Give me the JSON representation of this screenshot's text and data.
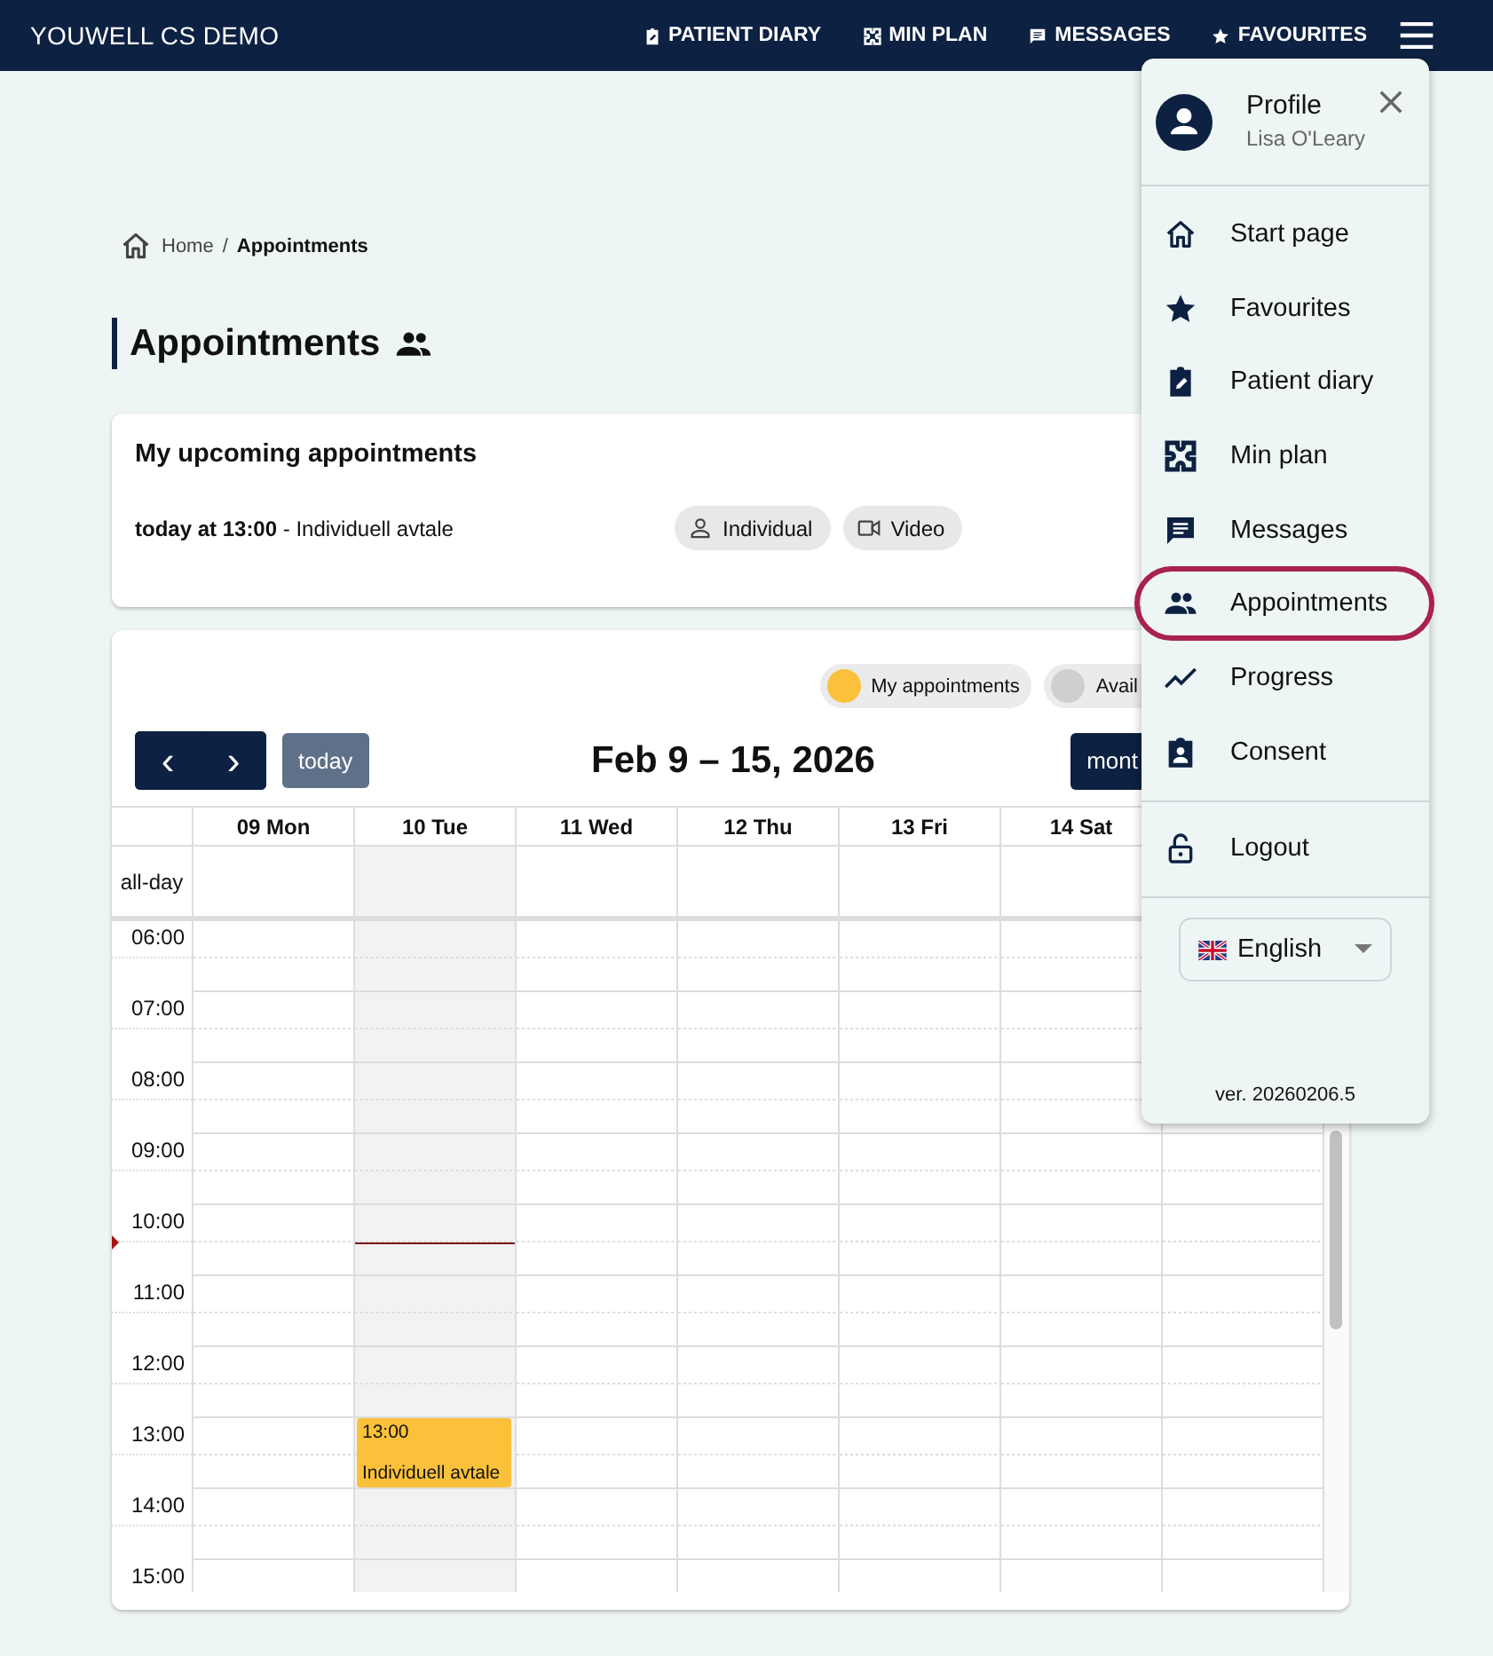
{
  "header": {
    "brand": "YOUWELL CS DEMO",
    "nav": [
      {
        "label": "PATIENT DIARY",
        "kind": "diary"
      },
      {
        "label": "MIN PLAN",
        "kind": "plan"
      },
      {
        "label": "MESSAGES",
        "kind": "messages"
      },
      {
        "label": "FAVOURITES",
        "kind": "star"
      }
    ]
  },
  "breadcrumb": {
    "home": "Home",
    "separator": "/",
    "current": "Appointments"
  },
  "page_title": "Appointments",
  "upcoming": {
    "title": "My upcoming appointments",
    "items": [
      {
        "when": "today at 13:00",
        "title": " - Individuell avtale",
        "tags": [
          {
            "label": "Individual",
            "kind": "person"
          },
          {
            "label": "Video",
            "kind": "video"
          }
        ]
      }
    ]
  },
  "calendar": {
    "legend": [
      {
        "label": "My appointments",
        "color": "#fbc13a"
      },
      {
        "label": "Avail",
        "color": "#cfcfcf"
      }
    ],
    "prev": "‹",
    "next": "›",
    "today_button": "today",
    "title": "Feb 9 – 15, 2026",
    "view_button": "mont",
    "all_day": "all-day",
    "days": [
      {
        "label": "09 Mon",
        "today": false
      },
      {
        "label": "10 Tue",
        "today": true,
        "events": [
          {
            "time": "13:00",
            "title": "Individuell avtale",
            "color": "#fbc13a"
          }
        ]
      },
      {
        "label": "11 Wed",
        "today": false
      },
      {
        "label": "12 Thu",
        "today": false
      },
      {
        "label": "13 Fri",
        "today": false
      },
      {
        "label": "14 Sat",
        "today": false
      },
      {
        "today": false
      }
    ],
    "hours": [
      "06:00",
      "07:00",
      "08:00",
      "09:00",
      "10:00",
      "11:00",
      "12:00",
      "13:00",
      "14:00",
      "15:00"
    ]
  },
  "menu": {
    "profile": {
      "title": "Profile",
      "name": "Lisa O'Leary"
    },
    "items": [
      {
        "label": "Start page",
        "kind": "home",
        "selected": false
      },
      {
        "label": "Favourites",
        "kind": "star",
        "selected": false
      },
      {
        "label": "Patient diary",
        "kind": "diary",
        "selected": false
      },
      {
        "label": "Min plan",
        "kind": "plan",
        "selected": false
      },
      {
        "label": "Messages",
        "kind": "messages",
        "selected": false
      },
      {
        "label": "Appointments",
        "kind": "people",
        "selected": true
      },
      {
        "label": "Progress",
        "kind": "progress",
        "selected": false
      },
      {
        "label": "Consent",
        "kind": "consent",
        "selected": false
      }
    ],
    "logout": "Logout",
    "language": "English",
    "version": "ver. 20260206.5"
  }
}
